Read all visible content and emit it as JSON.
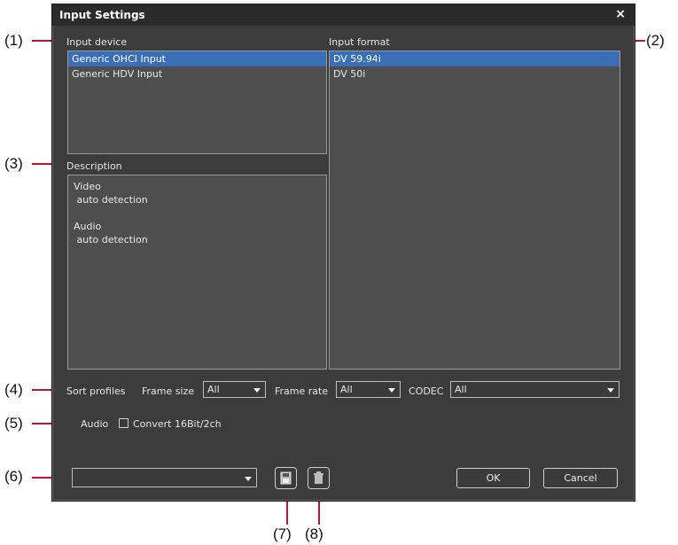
{
  "dialog": {
    "title": "Input Settings",
    "close_glyph": "×"
  },
  "input_device": {
    "label": "Input device",
    "items": [
      "Generic OHCI Input",
      "Generic HDV Input"
    ],
    "selected_index": 0
  },
  "input_format": {
    "label": "Input format",
    "items": [
      "DV 59.94i",
      "DV 50i"
    ],
    "selected_index": 0
  },
  "description": {
    "label": "Description",
    "lines": [
      "Video",
      " auto detection",
      "",
      "Audio",
      " auto detection"
    ]
  },
  "sort_profiles": {
    "label": "Sort profiles",
    "frame_size": {
      "label": "Frame size",
      "value": "All"
    },
    "frame_rate": {
      "label": "Frame rate",
      "value": "All"
    },
    "codec": {
      "label": "CODEC",
      "value": "All"
    }
  },
  "audio": {
    "label": "Audio",
    "checkbox_label": "Convert 16Bit/2ch",
    "checked": false
  },
  "preset": {
    "value": ""
  },
  "buttons": {
    "ok": "OK",
    "cancel": "Cancel"
  },
  "icons": {
    "save": "save-icon",
    "delete": "delete-icon"
  },
  "callouts": [
    "(1)",
    "(2)",
    "(3)",
    "(4)",
    "(5)",
    "(6)",
    "(7)",
    "(8)"
  ],
  "colors": {
    "accent": "#3a6fb7",
    "callout_line": "#c8102e",
    "dialog_bg": "#3c3c3c"
  }
}
